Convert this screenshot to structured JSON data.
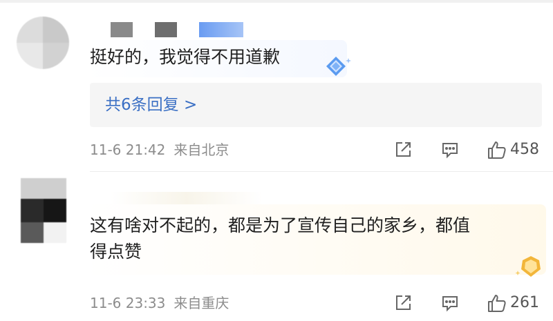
{
  "comments": [
    {
      "text_lines": [
        "挺好的，我觉得不用道歉"
      ],
      "replies_label": "共6条回复 >",
      "date": "11-6 21:42",
      "location": "来自北京",
      "likes": "458"
    },
    {
      "text_lines": [
        "这有啥对不起的，都是为了宣传自己的家乡，都值",
        "得点赞"
      ],
      "date": "11-6 23:33",
      "location": "来自重庆",
      "likes": "261"
    }
  ],
  "colors": {
    "link": "#3a6fc4",
    "meta": "#8c8c8c",
    "badge_blue": "#5b9bf0",
    "badge_gold": "#f2b63a"
  },
  "icons": [
    "share-icon",
    "comment-icon",
    "like-icon",
    "badge-icon"
  ]
}
